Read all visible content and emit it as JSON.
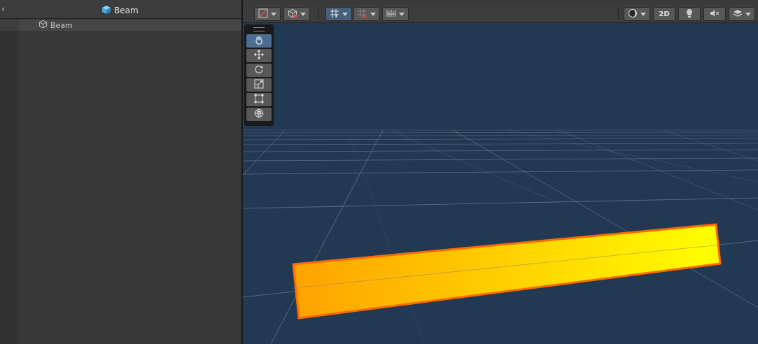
{
  "hierarchy": {
    "title": "Beam",
    "title_icon": "prefab-cube-icon",
    "back_icon": "chevron-left-icon",
    "items": [
      {
        "label": "Beam",
        "icon": "gameobject-cube-icon",
        "selected": true
      }
    ]
  },
  "scene": {
    "toolbar": {
      "buttons": [
        {
          "name": "gizmo-draw-mode",
          "icon": "draw-mode-icon",
          "dropdown": true
        },
        {
          "name": "view-options",
          "icon": "cube-view-icon",
          "dropdown": true
        },
        {
          "name": "grid-snapping",
          "icon": "grid-y-icon",
          "dropdown": true,
          "active": true
        },
        {
          "name": "increment-snap",
          "icon": "snap-increment-icon",
          "dropdown": true
        },
        {
          "name": "ruler",
          "icon": "ruler-icon",
          "dropdown": true
        },
        {
          "name": "shading-mode",
          "icon": "shading-sphere-icon",
          "dropdown": true
        },
        {
          "name": "mode-2d",
          "label": "2D"
        },
        {
          "name": "lighting-toggle",
          "icon": "light-bulb-icon"
        },
        {
          "name": "audio-toggle",
          "icon": "audio-mute-icon"
        },
        {
          "name": "effects-toggle",
          "icon": "layers-icon",
          "dropdown": true
        }
      ],
      "mode_2d_label": "2D"
    },
    "tools": [
      {
        "name": "hand-tool",
        "icon": "hand-icon",
        "active": true
      },
      {
        "name": "move-tool",
        "icon": "move-arrows-icon"
      },
      {
        "name": "rotate-tool",
        "icon": "rotate-icon"
      },
      {
        "name": "scale-tool",
        "icon": "scale-icon"
      },
      {
        "name": "rect-tool",
        "icon": "rect-transform-icon"
      },
      {
        "name": "transform-tool",
        "icon": "transform-icon"
      }
    ],
    "colors": {
      "background": "#213953",
      "grid_line": "#7f8a96",
      "beam_gradient_start": "#ffa200",
      "beam_gradient_end": "#ffff00",
      "beam_outline": "#ff6a00",
      "tool_active": "#4d6e93",
      "toolbar_active": "#46607c"
    }
  }
}
